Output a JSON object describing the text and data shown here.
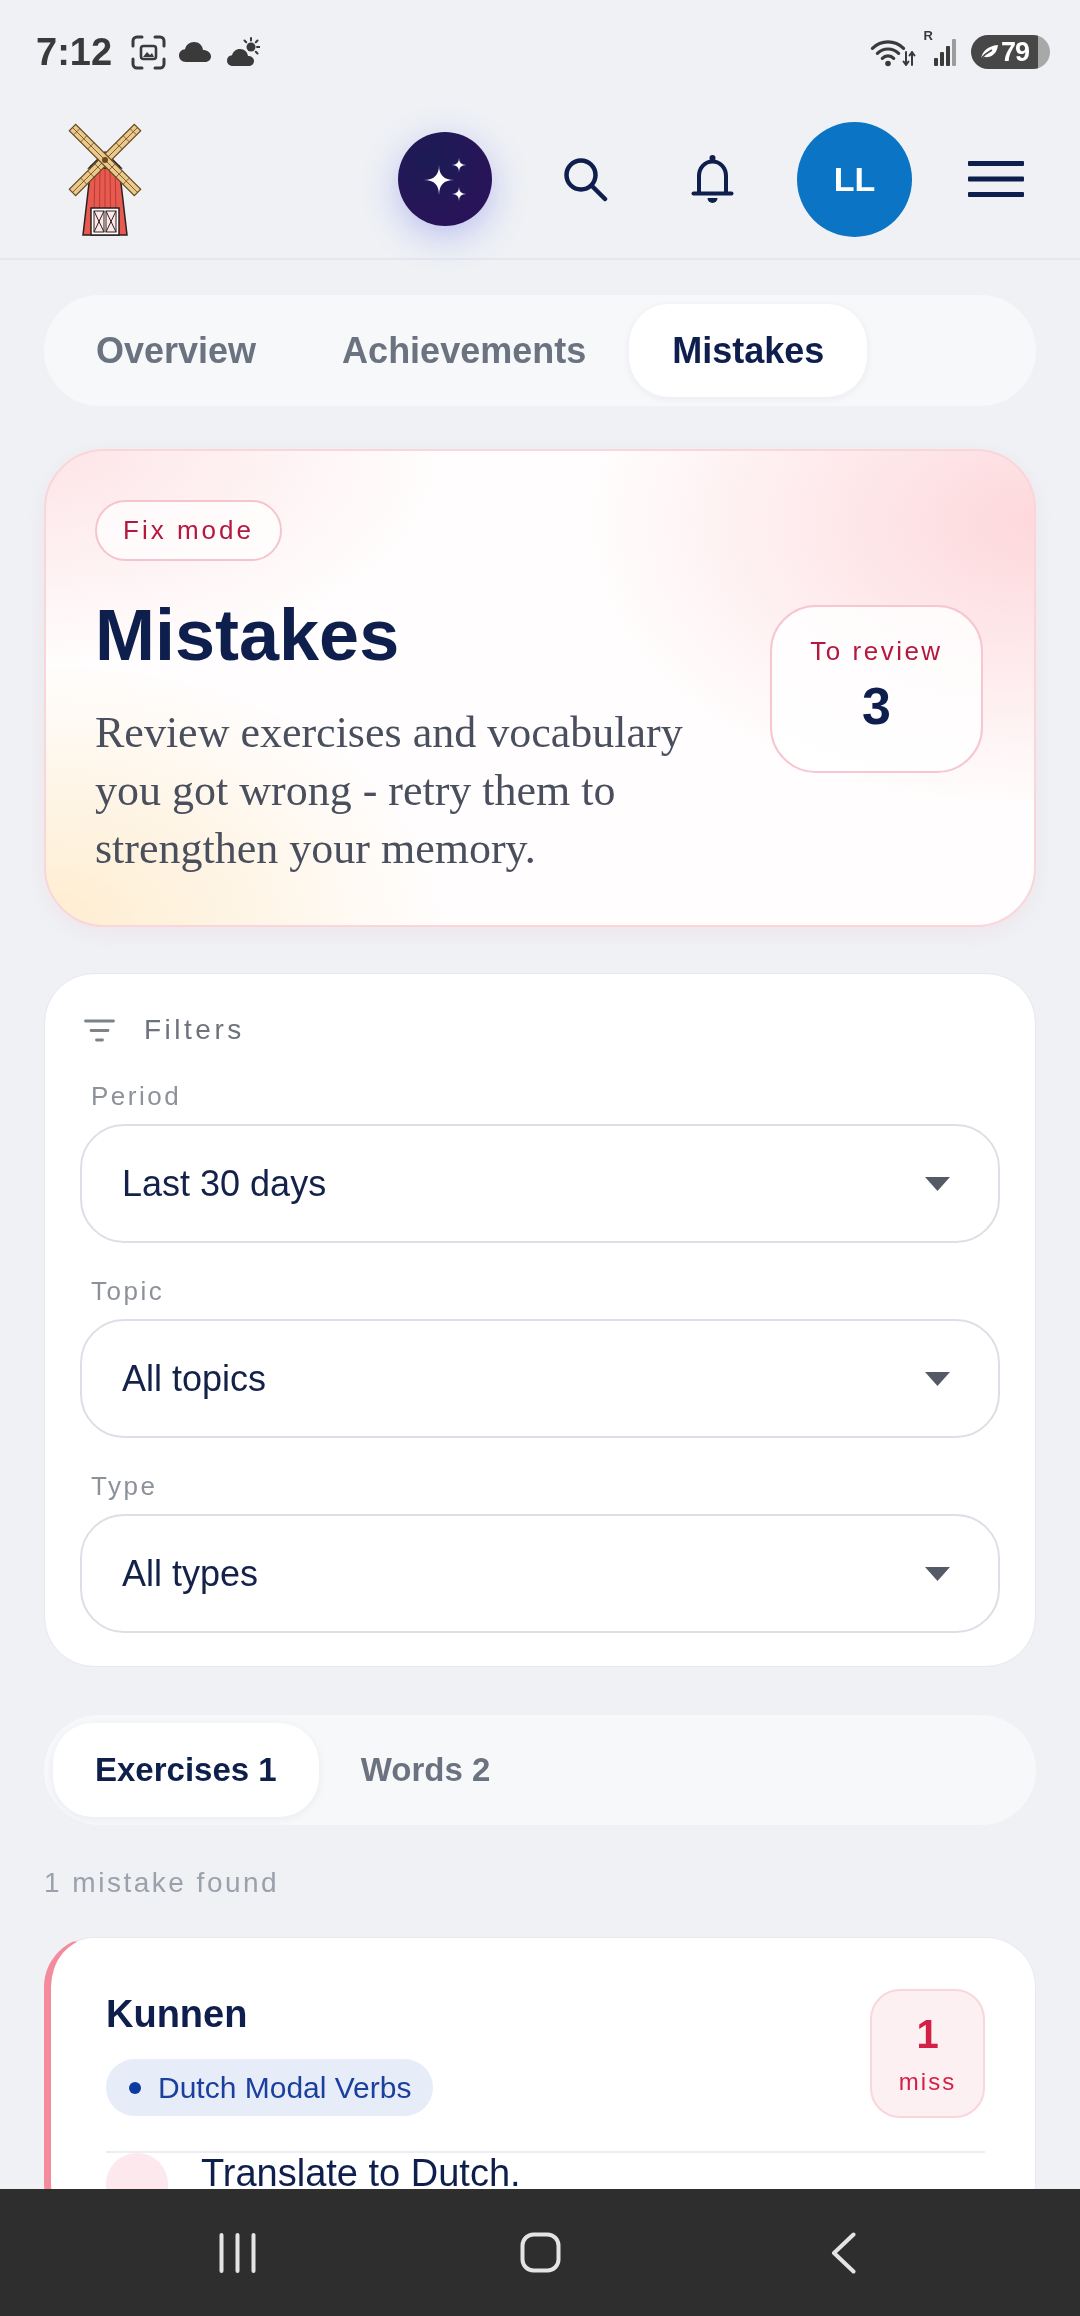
{
  "status_bar": {
    "time": "7:12",
    "roaming": "R",
    "battery": "79"
  },
  "header": {
    "avatar": "LL"
  },
  "tabs": [
    {
      "label": "Overview",
      "selected": false
    },
    {
      "label": "Achievements",
      "selected": false
    },
    {
      "label": "Mistakes",
      "selected": true
    }
  ],
  "hero": {
    "badge": "Fix mode",
    "title": "Mistakes",
    "description": "Review exercises and vocabulary you got wrong - retry them to strengthen your memory.",
    "review": {
      "label": "To review",
      "count": "3"
    }
  },
  "filters": {
    "title": "Filters",
    "fields": [
      {
        "label": "Period",
        "value": "Last 30 days"
      },
      {
        "label": "Topic",
        "value": "All topics"
      },
      {
        "label": "Type",
        "value": "All types"
      }
    ]
  },
  "list_tabs": [
    {
      "label": "Exercises 1",
      "selected": true
    },
    {
      "label": "Words 2",
      "selected": false
    }
  ],
  "result_count": "1 mistake found",
  "mistakes": [
    {
      "title": "Kunnen",
      "topic": "Dutch Modal Verbs",
      "misses": "1",
      "miss_label": "miss",
      "items": [
        {
          "prompt": "Translate to Dutch."
        }
      ]
    }
  ]
}
